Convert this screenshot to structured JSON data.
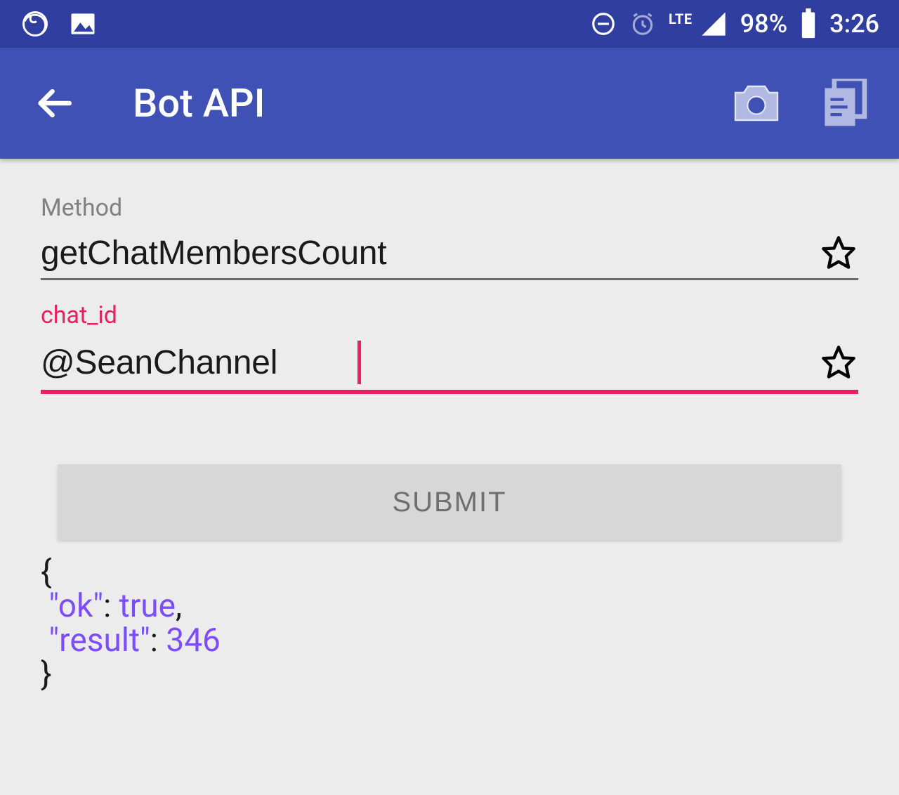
{
  "status_bar": {
    "battery_percent": "98%",
    "time": "3:26",
    "network_label": "LTE"
  },
  "app_bar": {
    "title": "Bot API"
  },
  "fields": {
    "method": {
      "label": "Method",
      "value": "getChatMembersCount"
    },
    "chat_id": {
      "label": "chat_id",
      "value": "@SeanChannel"
    }
  },
  "submit": {
    "label": "SUBMIT"
  },
  "result": {
    "brace_open": "{",
    "brace_close": "}",
    "line1_key": "\"ok\"",
    "line1_val": "true",
    "line2_key": "\"result\"",
    "line2_val": "346",
    "colon_sep": ": ",
    "comma": ","
  }
}
